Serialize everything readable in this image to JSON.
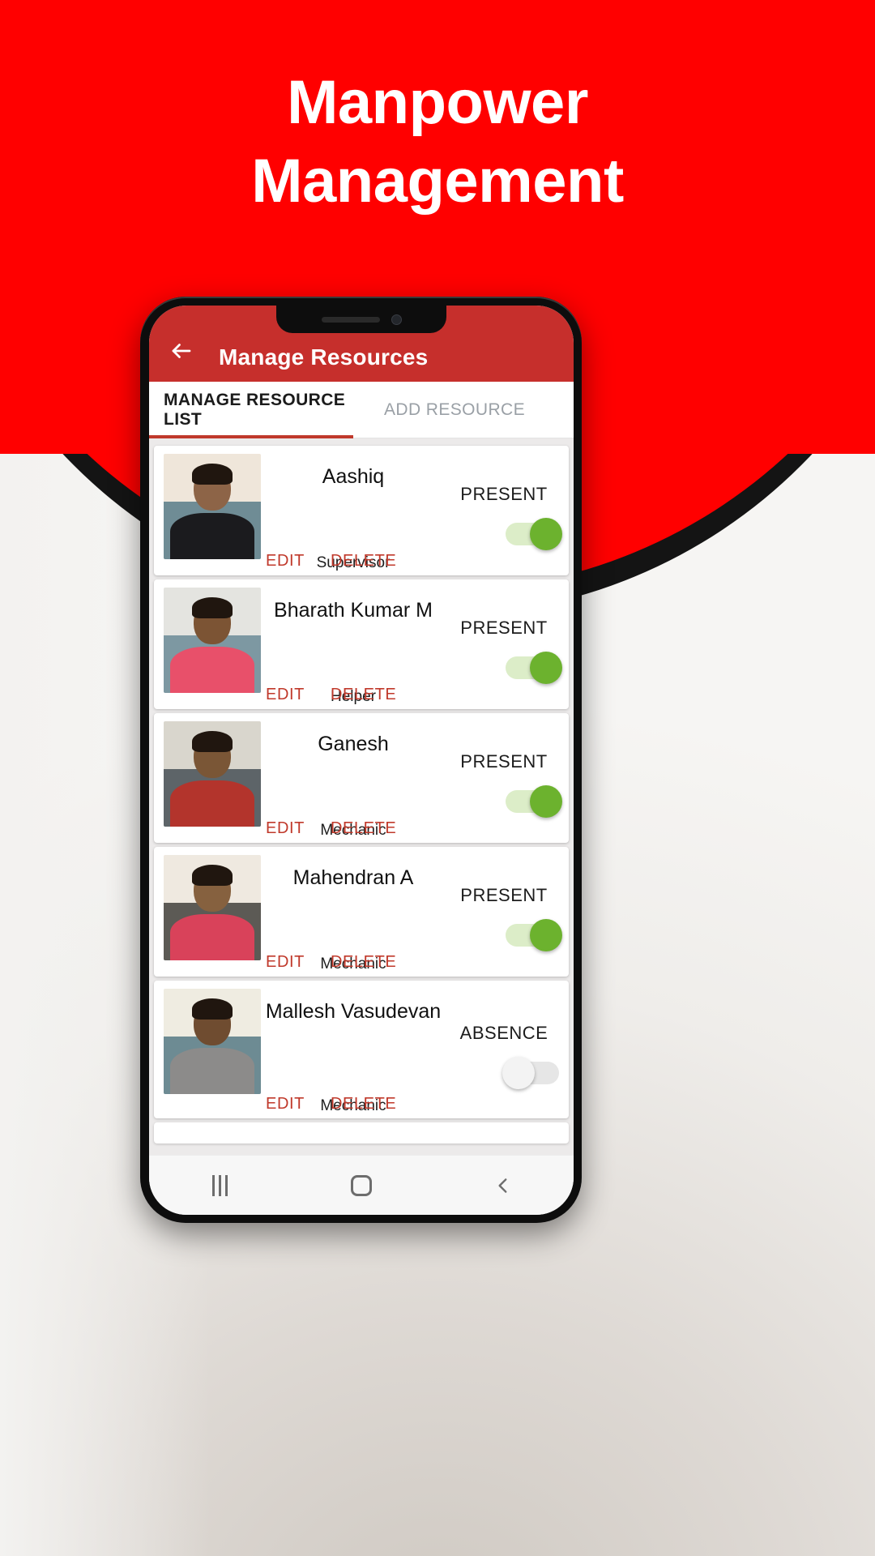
{
  "promo": {
    "title_line1": "Manpower",
    "title_line2": "Management",
    "bg_color": "#FF0000",
    "title_color": "#FFFFFF"
  },
  "app": {
    "appbar": {
      "back_icon": "arrow-left-icon",
      "title": "Manage Resources",
      "bg_color": "#C62F2C"
    },
    "tabs": [
      {
        "label": "MANAGE RESOURCE LIST",
        "selected": true
      },
      {
        "label": "ADD RESOURCE",
        "selected": false
      }
    ],
    "tab_indicator_color": "#C0392B",
    "actions": {
      "edit": "EDIT",
      "delete": "DELETE",
      "color": "#C0392B"
    },
    "status_labels": {
      "present": "PRESENT",
      "absence": "ABSENCE"
    },
    "toggle_on_color": "#6CB22E",
    "toggle_on_track": "#DCEDC8",
    "toggle_off_color": "#F3F3F3",
    "resources": [
      {
        "name": "Aashiq",
        "role": "Supervisor",
        "status": "PRESENT",
        "toggle": "on",
        "edit": "EDIT",
        "delete": "DELETE",
        "photo": {
          "bg_top": "#efe6da",
          "bg_bottom": "#6f8c95",
          "skin": "#8d6447",
          "shirt": "#1b1b1e"
        }
      },
      {
        "name": "Bharath Kumar M",
        "role": "Helper",
        "status": "PRESENT",
        "toggle": "on",
        "edit": "EDIT",
        "delete": "DELETE",
        "photo": {
          "bg_top": "#e4e4e0",
          "bg_bottom": "#7d98a2",
          "skin": "#7c5434",
          "shirt": "#e8506a"
        }
      },
      {
        "name": "Ganesh",
        "role": "Mechanic",
        "status": "PRESENT",
        "toggle": "on",
        "edit": "EDIT",
        "delete": "DELETE",
        "photo": {
          "bg_top": "#d9d6cd",
          "bg_bottom": "#5d6468",
          "skin": "#7a5636",
          "shirt": "#b3342c"
        }
      },
      {
        "name": "Mahendran A",
        "role": "Mechanic",
        "status": "PRESENT",
        "toggle": "on",
        "edit": "EDIT",
        "delete": "DELETE",
        "photo": {
          "bg_top": "#efe9e0",
          "bg_bottom": "#5c5a55",
          "skin": "#86613f",
          "shirt": "#d9425a"
        }
      },
      {
        "name": "Mallesh Vasudevan",
        "role": "Mechanic",
        "status": "ABSENCE",
        "toggle": "off",
        "edit": "EDIT",
        "delete": "DELETE",
        "photo": {
          "bg_top": "#efece1",
          "bg_bottom": "#6d8b93",
          "skin": "#6f4c30",
          "shirt": "#8c8b8a"
        }
      }
    ],
    "navbar": {
      "recents": "recents-icon",
      "home": "home-icon",
      "back": "back-icon"
    }
  }
}
